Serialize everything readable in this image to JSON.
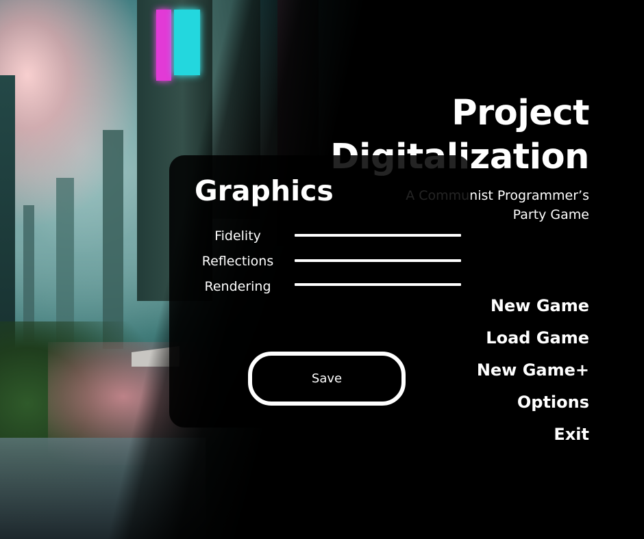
{
  "game": {
    "title_line1": "Project",
    "title_line2": "Digitalization",
    "subtitle_line1": "A Communist Programmer’s",
    "subtitle_line2": "Party Game"
  },
  "menu": {
    "items": [
      {
        "label": "New Game"
      },
      {
        "label": "Load Game"
      },
      {
        "label": "New Game+"
      },
      {
        "label": "Options"
      },
      {
        "label": "Exit"
      }
    ]
  },
  "graphics_panel": {
    "title": "Graphics",
    "options": [
      {
        "label": "Fidelity"
      },
      {
        "label": "Reflections"
      },
      {
        "label": "Rendering"
      }
    ],
    "save_label": "Save"
  },
  "colors": {
    "background": "#000000",
    "text": "#ffffff",
    "neon_pink": "#e23ad6",
    "neon_cyan": "#23d7de"
  }
}
